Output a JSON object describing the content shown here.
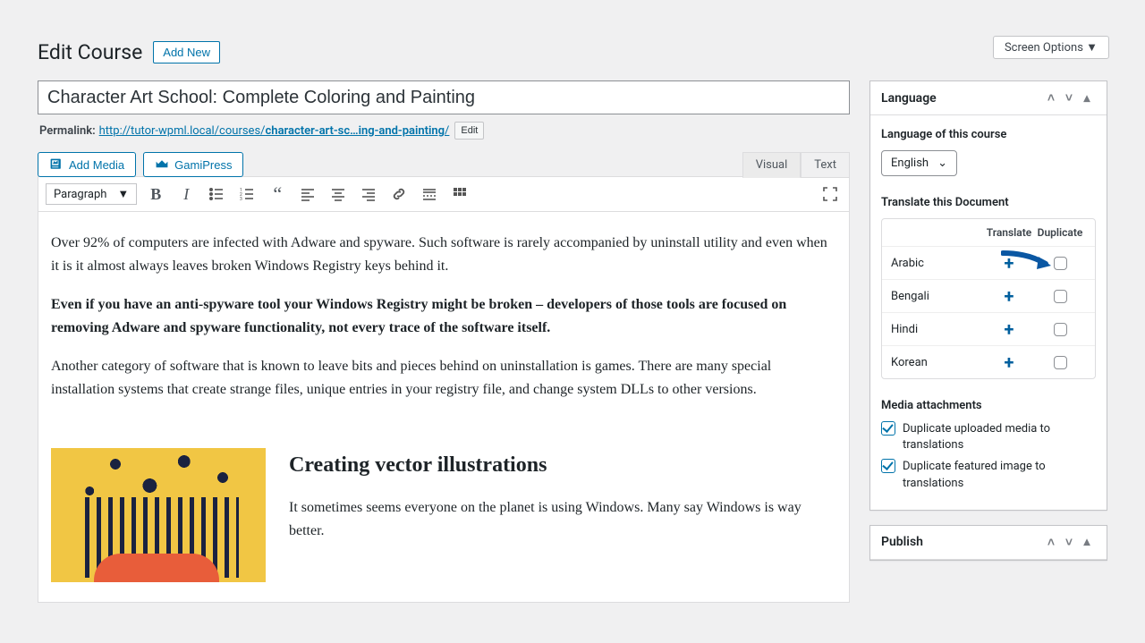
{
  "screenOptions": "Screen Options ▼",
  "pageTitle": "Edit Course",
  "addNew": "Add New",
  "titleValue": "Character Art School: Complete Coloring and Painting",
  "permalinkLabel": "Permalink:",
  "permalinkBase": "http://tutor-wpml.local/courses/",
  "permalinkSlug": "character-art-sc…ing-and-painting",
  "permalinkTrail": "/",
  "editSlug": "Edit",
  "addMedia": "Add Media",
  "gamiPress": "GamiPress",
  "tabs": {
    "visual": "Visual",
    "text": "Text"
  },
  "formatSelect": "Paragraph",
  "content": {
    "p1": "Over 92% of computers are infected with Adware and spyware. Such software is rarely accompanied by uninstall utility and even when it is it almost always leaves broken Windows Registry keys behind it.",
    "p2": "Even if you have an anti-spyware tool your Windows Registry might be broken – developers of those tools are focused on removing Adware and spyware functionality, not every trace of the software itself.",
    "p3": "Another category of software that is known to leave bits and pieces behind on uninstallation is games. There are many special installation systems that create strange files, unique entries in your registry file, and change system DLLs to other versions.",
    "h2": "Creating vector illustrations",
    "p4": "It sometimes seems everyone on the planet is using Windows. Many say Windows is way better."
  },
  "sidebar": {
    "language": {
      "panelTitle": "Language",
      "ofThisCourse": "Language of this course",
      "selected": "English",
      "translateLabel": "Translate this Document",
      "cols": {
        "translate": "Translate",
        "duplicate": "Duplicate"
      },
      "rows": [
        "Arabic",
        "Bengali",
        "Hindi",
        "Korean"
      ],
      "mediaLabel": "Media attachments",
      "cb1": "Duplicate uploaded media to translations",
      "cb2": "Duplicate featured image to translations"
    },
    "publish": {
      "panelTitle": "Publish"
    }
  }
}
